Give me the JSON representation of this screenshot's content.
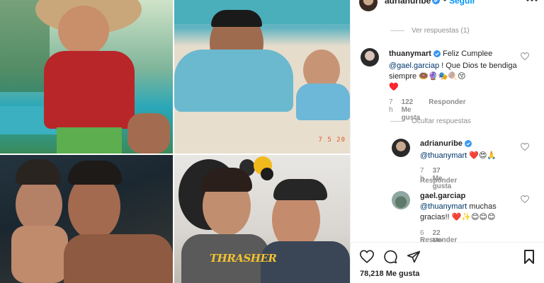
{
  "header": {
    "username": "adrianuribe",
    "separator": "•",
    "follow_label": "Seguir"
  },
  "thread_top": {
    "label": "Ver respuestas (1)"
  },
  "main_comment": {
    "username": "thuanymart",
    "text_1": "Feliz Cumplee",
    "mention": "@gael.garciap",
    "text_2": "! Que Dios te bendiga siempre 🍩🔮🎭🍭😚",
    "text_3": "♥️",
    "time": "7 h",
    "likes": "122 Me gusta",
    "reply": "Responder"
  },
  "thread_mid": {
    "label": "Ocultar respuestas"
  },
  "reply_1": {
    "username": "adrianuribe",
    "mention": "@thuanymart",
    "text": "❤️😍🙏",
    "time": "7 h",
    "likes": "37 Me gusta",
    "reply": "Responder"
  },
  "reply_2": {
    "username": "gael.garciap",
    "mention": "@thuanymart",
    "text_1": "muchas",
    "text_2": "gracias!! ❤️✨😊😊😊",
    "time": "6 h",
    "likes": "22 Me gusta",
    "reply": "Responder"
  },
  "photo_overlays": {
    "date_stamp": "7 5 20",
    "shirt_text": "THRASHER"
  },
  "footer": {
    "likes_count": "78,218 Me gusta"
  },
  "colors": {
    "link": "#0095f6",
    "verified": "#3897f0",
    "like_red": "#ed4956",
    "muted": "#8e8e8e"
  },
  "icons": [
    "verified-badge-icon",
    "more-options-icon",
    "heart-icon",
    "comment-icon",
    "share-icon",
    "bookmark-icon"
  ]
}
